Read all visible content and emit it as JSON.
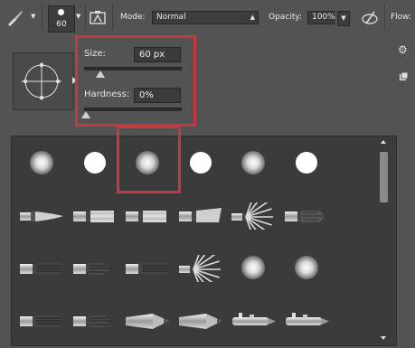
{
  "toolbar": {
    "brush_size": "60",
    "mode_label": "Mode:",
    "mode_value": "Normal",
    "opacity_label": "Opacity:",
    "opacity_value": "100%",
    "flow_label": "Flow:"
  },
  "brush_panel": {
    "size_label": "Size:",
    "size_value": "60 px",
    "size_slider_percent": 0.17,
    "hardness_label": "Hardness:",
    "hardness_value": "0%",
    "hardness_slider_percent": 0.0
  },
  "presets": {
    "rows": [
      [
        "soft-round",
        "hard-round",
        "soft-round",
        "hard-round",
        "soft-round",
        "hard-round"
      ],
      [
        "pointed-brush",
        "flat-brush",
        "flat-brush",
        "angled-brush",
        "fan-brush",
        "round-bristle-brush"
      ],
      [
        "flat-bristle",
        "round-bristle",
        "flat-bristle",
        "fan-brush",
        "soft-round",
        "soft-round"
      ],
      [
        "flat-bristle",
        "round-bristle",
        "pencil",
        "pencil",
        "airbrush",
        "airbrush"
      ]
    ],
    "selected_index": 2
  },
  "colors": {
    "highlight": "#c7373f",
    "toolbar_bg": "#535353",
    "grid_bg": "#3b3b3b"
  }
}
